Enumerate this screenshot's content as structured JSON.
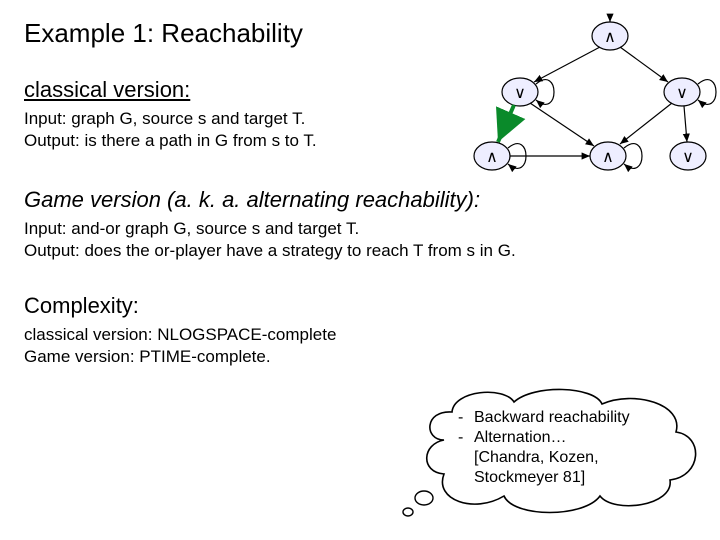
{
  "title": "Example 1: Reachability",
  "classical": {
    "heading": "classical version:",
    "input": "Input: graph G, source s and target T.",
    "output": "Output: is there a path in G from s to T."
  },
  "game": {
    "heading": "Game version (a. k. a. alternating reachability):",
    "input": "Input: and-or graph G, source s and target T.",
    "output": "Output: does the or-player have a strategy to reach T from s in G."
  },
  "complexity": {
    "heading": "Complexity:",
    "classical": "classical version: NLOGSPACE-complete",
    "game": "Game version:  PTIME-complete."
  },
  "cloud": {
    "l1": "Backward reachability",
    "l2": "Alternation…",
    "l3": "[Chandra, Kozen,",
    "l4": "Stockmeyer 81]"
  },
  "graph": {
    "and": "∧",
    "or": "∨"
  }
}
